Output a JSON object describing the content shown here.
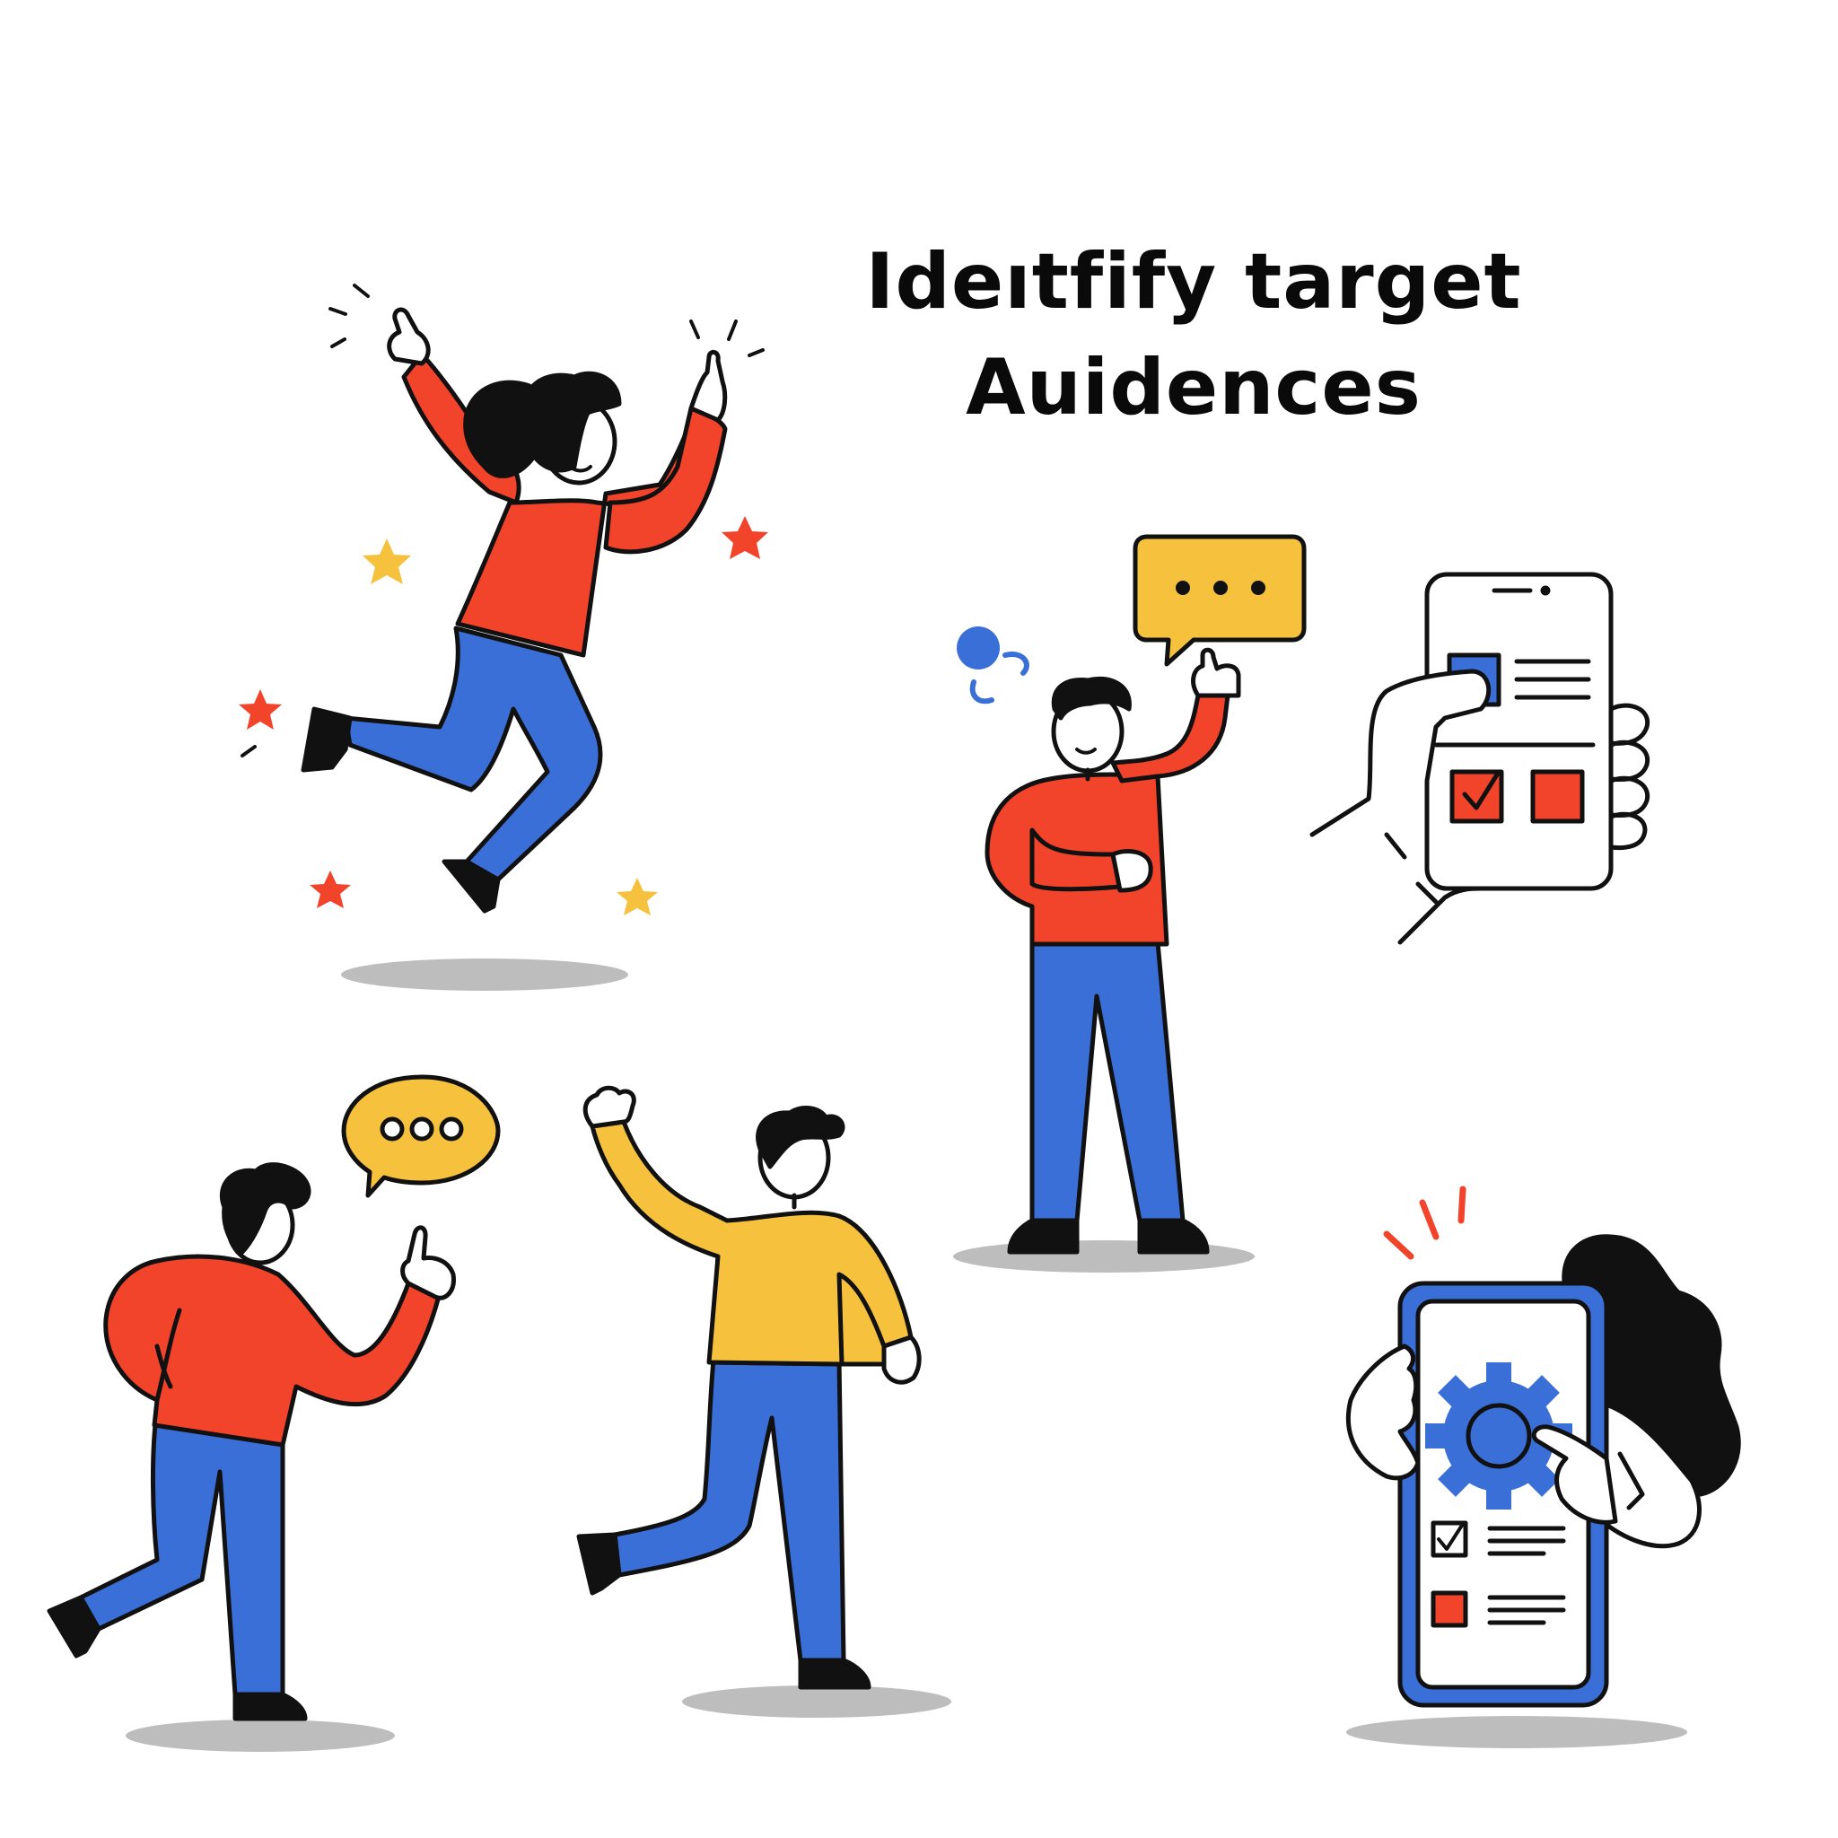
{
  "title": {
    "line1": "Ideıtfify target",
    "line2": "Auidences"
  },
  "palette": {
    "red": "#F2432B",
    "blue": "#3B6FD8",
    "yellow": "#F6C23E",
    "ink": "#111111",
    "shadow": "#BDBDBD"
  },
  "icons": [
    "speech-bubble-icon",
    "chat-bubble-icon",
    "phone-checklist-icon",
    "gear-icon",
    "checkbox-icon",
    "star-icon"
  ]
}
